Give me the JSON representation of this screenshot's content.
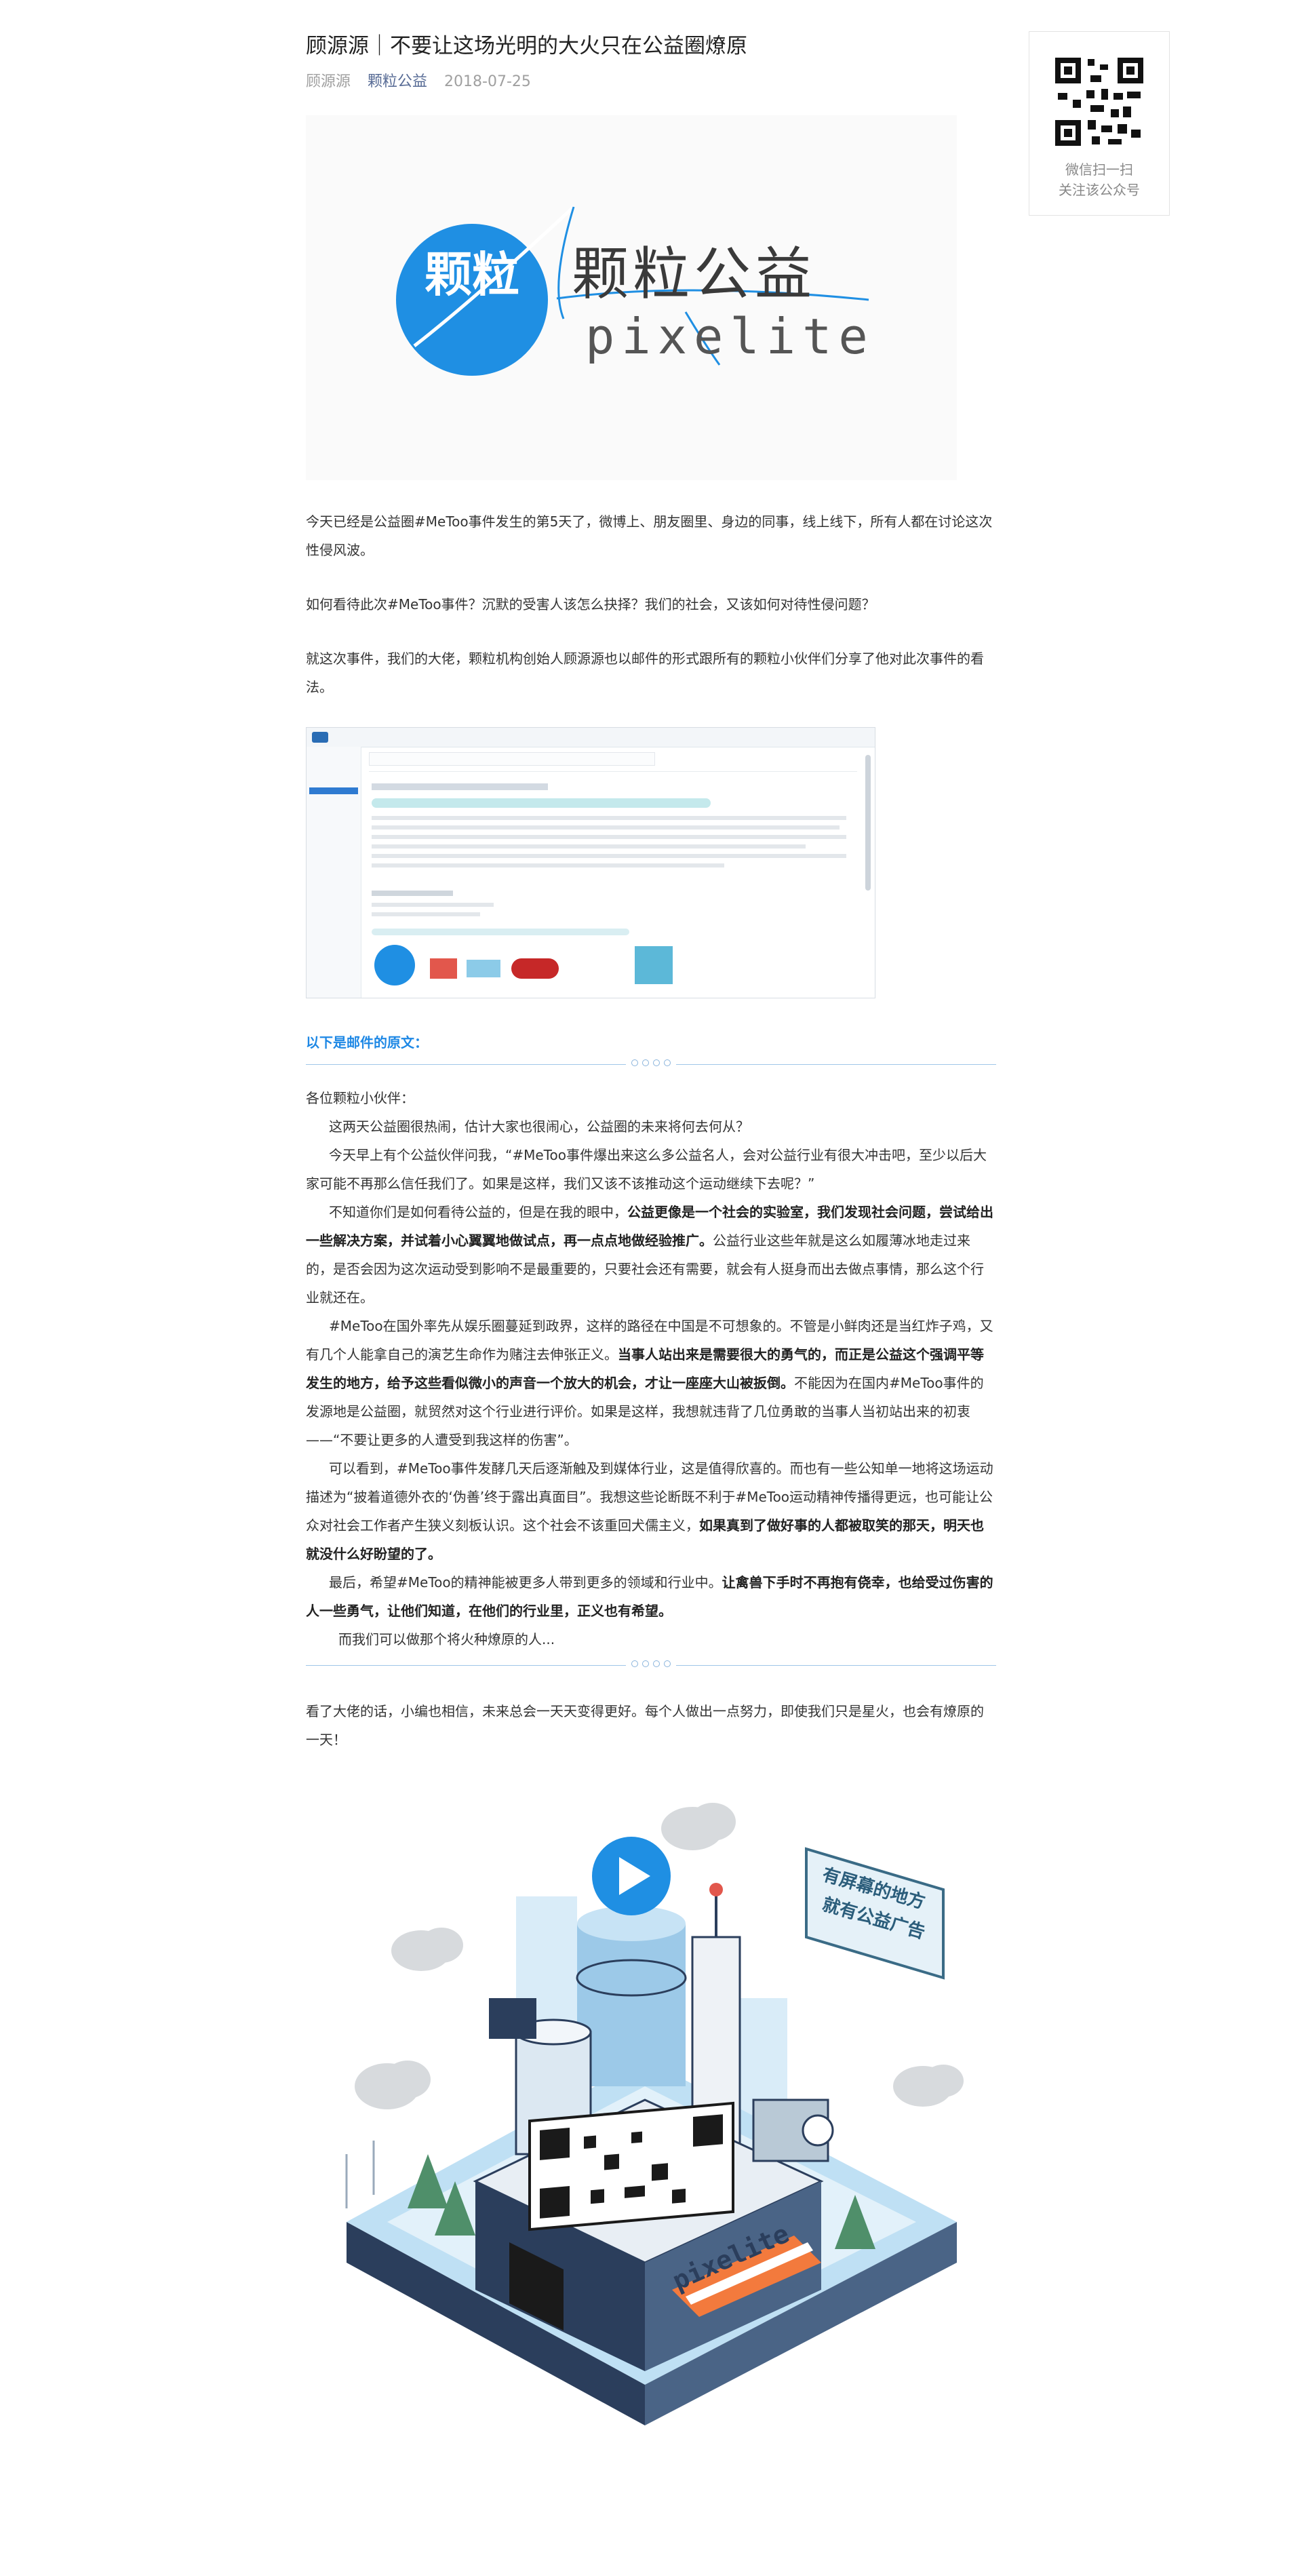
{
  "article": {
    "title": "顾源源｜不要让这场光明的大火只在公益圈燎原",
    "author": "顾源源",
    "account": "颗粒公益",
    "date": "2018-07-25"
  },
  "logo": {
    "circle_text": "颗粒",
    "cn_name": "颗粒公益",
    "en_name": "pixelite",
    "colors": {
      "primary": "#1f8fe3",
      "text": "#3a3a3a"
    }
  },
  "intro_paragraphs": [
    "今天已经是公益圈#MeToo事件发生的第5天了，微博上、朋友圈里、身边的同事，线上线下，所有人都在讨论这次性侵风波。",
    "如何看待此次#MeToo事件？沉默的受害人该怎么抉择？我们的社会，又该如何对待性侵问题？",
    "就这次事件，我们的大佬，颗粒机构创始人顾源源也以邮件的形式跟所有的颗粒小伙伴们分享了他对此次事件的看法。"
  ],
  "email_heading": "以下是邮件的原文：",
  "letter": {
    "greeting": "各位颗粒小伙伴：",
    "p1": "这两天公益圈很热闹，估计大家也很闹心，公益圈的未来将何去何从？",
    "p2": "今天早上有个公益伙伴问我，“#MeToo事件爆出来这么多公益名人，会对公益行业有很大冲击吧，至少以后大家可能不再那么信任我们了。如果是这样，我们又该不该推动这个运动继续下去呢？”",
    "p3a": "不知道你们是如何看待公益的，但是在我的眼中，",
    "p3b": "公益更像是一个社会的实验室，我们发现社会问题，尝试给出一些解决方案，并试着小心翼翼地做试点，再一点点地做经验推广。",
    "p3c": "公益行业这些年就是这么如履薄冰地走过来的，是否会因为这次运动受到影响不是最重要的，只要社会还有需要，就会有人挺身而出去做点事情，那么这个行业就还在。",
    "p4a": "#MeToo在国外率先从娱乐圈蔓延到政界，这样的路径在中国是不可想象的。不管是小鲜肉还是当红炸子鸡，又有几个人能拿自己的演艺生命作为赌注去伸张正义。",
    "p4b": "当事人站出来是需要很大的勇气的，而正是公益这个强调平等发生的地方，给予这些看似微小的声音一个放大的机会，才让一座座大山被扳倒。",
    "p4c": "不能因为在国内#MeToo事件的发源地是公益圈，就贸然对这个行业进行评价。如果是这样，我想就违背了几位勇敢的当事人当初站出来的初衷——“不要让更多的人遭受到我这样的伤害”。",
    "p5a": "可以看到，#MeToo事件发酵几天后逐渐触及到媒体行业，这是值得欣喜的。而也有一些公知单一地将这场运动描述为“披着道德外衣的‘伪善’终于露出真面目”。我想这些论断既不利于#MeToo运动精神传播得更远，也可能让公众对社会工作者产生狭义刻板认识。这个社会不该重回犬儒主义，",
    "p5b": "如果真到了做好事的人都被取笑的那天，明天也就没什么好盼望的了。",
    "p6a": "最后，希望#MeToo的精神能被更多人带到更多的领域和行业中。",
    "p6b": "让禽兽下手时不再抱有侥幸，也给受过伤害的人一些勇气，让他们知道，在他们的行业里，正义也有希望。",
    "p7": "而我们可以做那个将火种燎原的人..."
  },
  "closing": "看了大佬的话，小编也相信，未来总会一天天变得更好。每个人做出一点努力，即使我们只是星火，也会有燎原的一天！",
  "poster": {
    "sign_line1": "有屏幕的地方",
    "sign_line2": "就有公益广告",
    "brand": "pixelite"
  },
  "sidebar": {
    "qr_caption_1": "微信扫一扫",
    "qr_caption_2": "关注该公众号"
  }
}
